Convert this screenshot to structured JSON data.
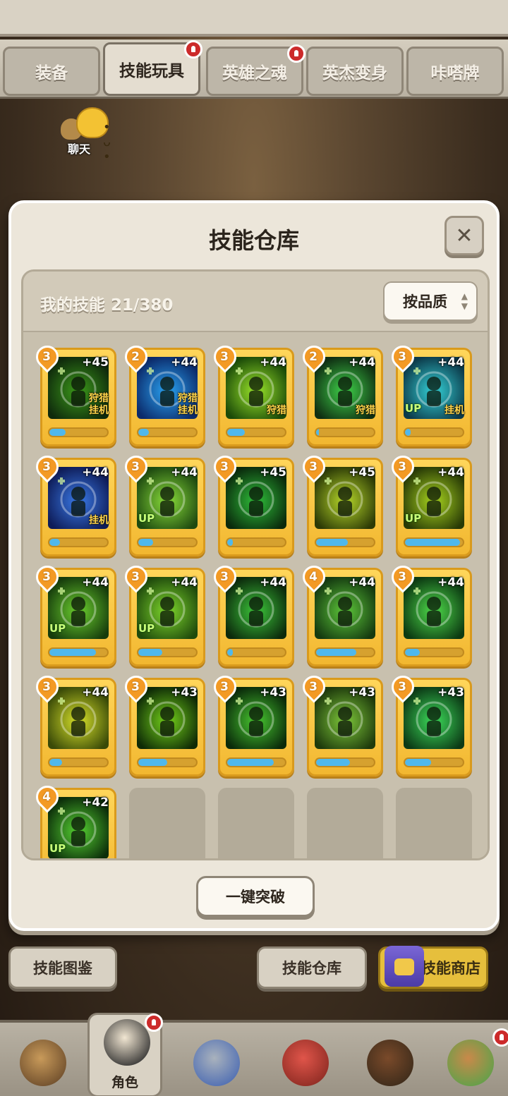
{
  "tabs": [
    {
      "label": "装备",
      "active": false,
      "alert": false
    },
    {
      "label": "技能玩具",
      "active": true,
      "alert": true
    },
    {
      "label": "英雄之魂",
      "active": false,
      "alert": true
    },
    {
      "label": "英杰变身",
      "active": false,
      "alert": false
    },
    {
      "label": "咔嗒牌",
      "active": false,
      "alert": false
    }
  ],
  "chat": {
    "label": "聊天"
  },
  "panel": {
    "title": "技能仓库",
    "close_icon": "close-icon",
    "count_label": "我的技能 21/380",
    "sort_label": "按品质",
    "break_button": "一键突破"
  },
  "skills": [
    {
      "rank": "3",
      "level": "+45",
      "tags": [
        "狩猎",
        "挂机"
      ],
      "up": false,
      "progress": 0.28,
      "icon": "ghost-hunter",
      "colors": [
        "#0f2a0c",
        "#3c9a1a"
      ]
    },
    {
      "rank": "2",
      "level": "+44",
      "tags": [
        "狩猎",
        "挂机"
      ],
      "up": false,
      "progress": 0.18,
      "icon": "blue-robot",
      "colors": [
        "#0b2a6a",
        "#2aa3f2"
      ]
    },
    {
      "rank": "3",
      "level": "+44",
      "tags": [
        "狩猎"
      ],
      "up": false,
      "progress": 0.3,
      "icon": "green-drop",
      "colors": [
        "#1b4a08",
        "#9be62a"
      ]
    },
    {
      "rank": "2",
      "level": "+44",
      "tags": [
        "狩猎"
      ],
      "up": false,
      "progress": 0.05,
      "icon": "healing-totem",
      "colors": [
        "#0f2e12",
        "#3fd34a"
      ]
    },
    {
      "rank": "3",
      "level": "+44",
      "tags": [
        "挂机"
      ],
      "up": true,
      "progress": 0.1,
      "icon": "slash",
      "colors": [
        "#0c3a4a",
        "#34d2d8"
      ]
    },
    {
      "rank": "3",
      "level": "+44",
      "tags": [
        "挂机"
      ],
      "up": false,
      "progress": 0.18,
      "icon": "shocked-shadow",
      "colors": [
        "#0e1c58",
        "#3a7ae8"
      ]
    },
    {
      "rank": "3",
      "level": "+44",
      "tags": [],
      "up": true,
      "progress": 0.25,
      "icon": "pedestal",
      "colors": [
        "#1e4a10",
        "#8ade3a"
      ]
    },
    {
      "rank": "3",
      "level": "+45",
      "tags": [],
      "up": false,
      "progress": 0.1,
      "icon": "heart-heal",
      "colors": [
        "#0a2a0c",
        "#2fbf3a"
      ]
    },
    {
      "rank": "3",
      "level": "+45",
      "tags": [],
      "up": false,
      "progress": 0.55,
      "icon": "flag-runner",
      "colors": [
        "#2c3a06",
        "#b8d92a"
      ]
    },
    {
      "rank": "3",
      "level": "+44",
      "tags": [],
      "up": true,
      "progress": 0.95,
      "icon": "cross-field",
      "colors": [
        "#283a06",
        "#a8d41e"
      ]
    },
    {
      "rank": "3",
      "level": "+44",
      "tags": [],
      "up": true,
      "progress": 0.8,
      "icon": "gear-cross",
      "colors": [
        "#163c0c",
        "#6cd02e"
      ]
    },
    {
      "rank": "3",
      "level": "+44",
      "tags": [],
      "up": true,
      "progress": 0.42,
      "icon": "stand-figure",
      "colors": [
        "#1f4a0c",
        "#7fd82c"
      ]
    },
    {
      "rank": "3",
      "level": "+44",
      "tags": [],
      "up": false,
      "progress": 0.1,
      "icon": "crown-shield",
      "colors": [
        "#0c2a0c",
        "#3cc63a"
      ]
    },
    {
      "rank": "4",
      "level": "+44",
      "tags": [],
      "up": false,
      "progress": 0.7,
      "icon": "box-robot",
      "colors": [
        "#143a10",
        "#5ec83a"
      ]
    },
    {
      "rank": "3",
      "level": "+44",
      "tags": [],
      "up": false,
      "progress": 0.25,
      "icon": "rune-stone",
      "colors": [
        "#0c3a12",
        "#4edb4a"
      ]
    },
    {
      "rank": "3",
      "level": "+44",
      "tags": [],
      "up": false,
      "progress": 0.22,
      "icon": "golden-idol",
      "colors": [
        "#3a4a08",
        "#d8e22a"
      ]
    },
    {
      "rank": "3",
      "level": "+43",
      "tags": [],
      "up": false,
      "progress": 0.5,
      "icon": "running-shadow",
      "colors": [
        "#0e2a06",
        "#74d21a"
      ]
    },
    {
      "rank": "3",
      "level": "+43",
      "tags": [],
      "up": false,
      "progress": 0.8,
      "icon": "dancing-shadow",
      "colors": [
        "#0a2a0a",
        "#48c830"
      ]
    },
    {
      "rank": "3",
      "level": "+43",
      "tags": [],
      "up": false,
      "progress": 0.58,
      "icon": "forest-golem",
      "colors": [
        "#1e3a0c",
        "#7ec83a"
      ]
    },
    {
      "rank": "3",
      "level": "+43",
      "tags": [],
      "up": false,
      "progress": 0.45,
      "icon": "green-pillar",
      "colors": [
        "#0c3a16",
        "#3cdc5a"
      ]
    },
    {
      "rank": "4",
      "level": "+42",
      "tags": [],
      "up": true,
      "progress": 0.3,
      "icon": "energy-orbs",
      "colors": [
        "#0c2e0a",
        "#56d232"
      ]
    }
  ],
  "up_label": "UP",
  "bottom_buttons": {
    "codex": "技能图鉴",
    "warehouse": "技能仓库",
    "shop": "技能商店"
  },
  "nav": [
    {
      "name": "nav-tribal",
      "label": ""
    },
    {
      "name": "nav-character",
      "label": "角色",
      "selected": true,
      "alert": true
    },
    {
      "name": "nav-weapons",
      "label": ""
    },
    {
      "name": "nav-dino",
      "label": ""
    },
    {
      "name": "nav-bear",
      "label": ""
    },
    {
      "name": "nav-shop-hero",
      "label": "",
      "alert": true
    }
  ]
}
